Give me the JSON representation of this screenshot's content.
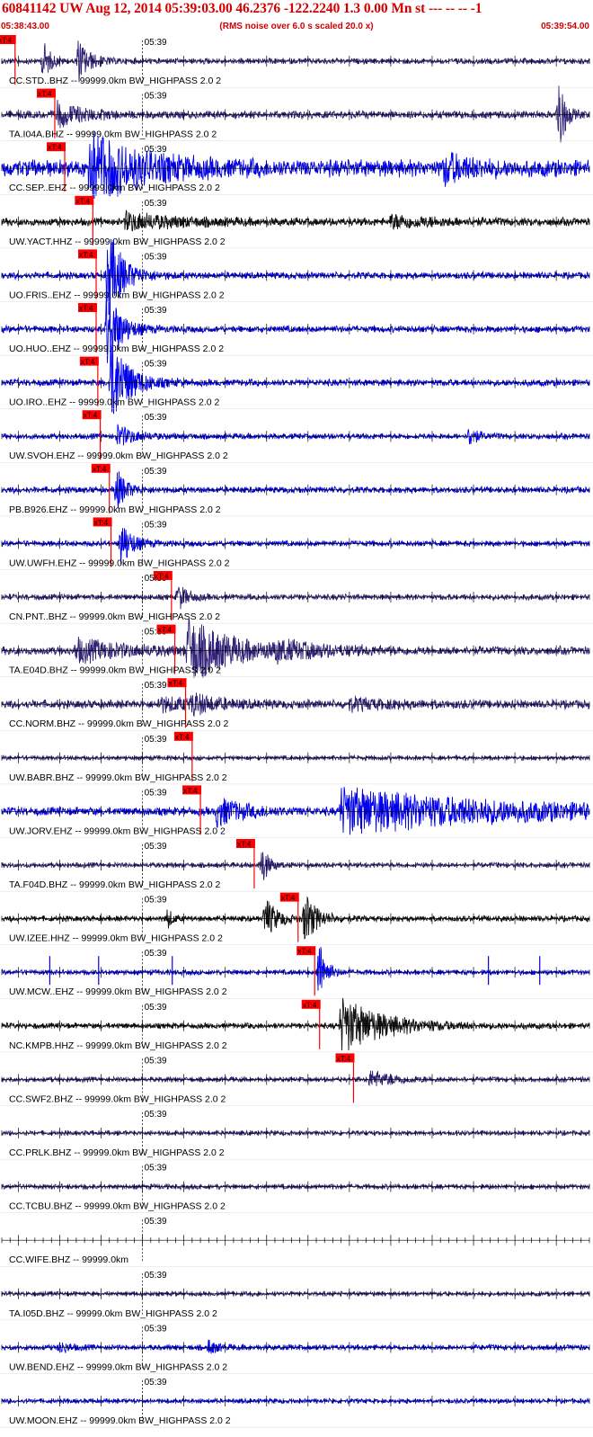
{
  "header": {
    "title": "60841142 UW Aug 12, 2014 05:39:03.00   46.2376 -122.2240  1.3 0.00 Mn st --- -- --  -1",
    "start_time": "05:38:43.00",
    "rms_note": "(RMS noise over 6.0 s scaled 20.0 x)",
    "end_time": "05:39:54.00"
  },
  "colors": {
    "header_text": "#d20000",
    "pick_flag": "#ff0000",
    "navy": "#33237a",
    "blue": "#0000ee",
    "black": "#111111",
    "axis": "#000000"
  },
  "chart_data": {
    "type": "line",
    "title": "60841142 UW Aug 12, 2014 05:39:03.00   46.2376 -122.2240  1.3 0.00 Mn st --- -- --  -1",
    "x_range": [
      "05:38:43.00",
      "05:39:54.00"
    ],
    "x_range_seconds": [
      0,
      71
    ],
    "minute_tick_label": "05:39",
    "minute_tick_second": 17,
    "pick_label": "xT:4",
    "traces": [
      {
        "label": "CC.STD..BHZ -- 99999.0km BW_HIGHPASS  2.0  2",
        "color": "navy",
        "pick_s": 1.6,
        "noise": 0.1,
        "events": [
          {
            "t": 5.0,
            "amp": 0.9,
            "dur": 0.8
          },
          {
            "t": 9.2,
            "amp": 0.9,
            "dur": 1.4
          }
        ]
      },
      {
        "label": "TA.I04A.BHZ -- 99999.0km BW_HIGHPASS  2.0  2",
        "color": "navy",
        "pick_s": 6.4,
        "noise": 0.14,
        "events": [
          {
            "t": 6.7,
            "amp": 0.5,
            "dur": 3.0
          },
          {
            "t": 67.3,
            "amp": 2.3,
            "dur": 0.6
          }
        ]
      },
      {
        "label": "CC.SEP..EHZ -- 99999.0km BW_HIGHPASS  2.0  2",
        "color": "blue",
        "pick_s": 7.6,
        "noise": 0.3,
        "events": [
          {
            "t": 10.5,
            "amp": 1.5,
            "dur": 6.0
          },
          {
            "t": 53.5,
            "amp": 0.55,
            "dur": 3.0
          }
        ]
      },
      {
        "label": "UW.YACT.HHZ -- 99999.0km BW_HIGHPASS  2.0  2",
        "color": "black",
        "pick_s": 11.0,
        "noise": 0.14,
        "events": [
          {
            "t": 15.0,
            "amp": 0.35,
            "dur": 6.0
          },
          {
            "t": 47.0,
            "amp": 0.25,
            "dur": 5.0
          }
        ]
      },
      {
        "label": "UO.FRIS..EHZ -- 99999.0km BW_HIGHPASS  2.0  2",
        "color": "blue",
        "pick_s": 11.4,
        "noise": 0.12,
        "events": [
          {
            "t": 12.8,
            "amp": 2.0,
            "dur": 1.8
          }
        ]
      },
      {
        "label": "UO.HUO..EHZ -- 99999.0km BW_HIGHPASS  2.0  2",
        "color": "blue",
        "pick_s": 11.4,
        "noise": 0.12,
        "events": [
          {
            "t": 12.7,
            "amp": 2.0,
            "dur": 1.5
          }
        ]
      },
      {
        "label": "UO.IRO..EHZ -- 99999.0km BW_HIGHPASS  2.0  2",
        "color": "blue",
        "pick_s": 11.6,
        "noise": 0.12,
        "events": [
          {
            "t": 13.2,
            "amp": 2.1,
            "dur": 2.0
          }
        ]
      },
      {
        "label": "UW.SVOH.EHZ -- 99999.0km BW_HIGHPASS  2.0  2",
        "color": "blue",
        "pick_s": 11.9,
        "noise": 0.1,
        "events": [
          {
            "t": 14.0,
            "amp": 0.45,
            "dur": 2.0
          },
          {
            "t": 56.5,
            "amp": 0.45,
            "dur": 0.9
          }
        ]
      },
      {
        "label": "PB.B926.EHZ -- 99999.0km BW_HIGHPASS  2.0  2",
        "color": "blue",
        "pick_s": 13.0,
        "noise": 0.11,
        "events": [
          {
            "t": 13.8,
            "amp": 0.9,
            "dur": 1.2
          }
        ]
      },
      {
        "label": "UW.UWFH.EHZ -- 99999.0km BW_HIGHPASS  2.0  2",
        "color": "blue",
        "pick_s": 13.2,
        "noise": 0.1,
        "events": [
          {
            "t": 14.4,
            "amp": 1.0,
            "dur": 1.3
          }
        ]
      },
      {
        "label": "CN.PNT..BHZ -- 99999.0km BW_HIGHPASS  2.0  2",
        "color": "navy",
        "pick_s": 20.5,
        "noise": 0.1,
        "events": [
          {
            "t": 21.3,
            "amp": 0.55,
            "dur": 1.2
          }
        ]
      },
      {
        "label": "TA.E04D.BHZ -- 99999.0km BW_HIGHPASS  2.0  2",
        "color": "navy",
        "pick_s": 20.9,
        "noise": 0.15,
        "events": [
          {
            "t": 9.0,
            "amp": 0.45,
            "dur": 6.0
          },
          {
            "t": 22.5,
            "amp": 1.35,
            "dur": 5.0
          },
          {
            "t": 33.0,
            "amp": 0.3,
            "dur": 6.0
          }
        ]
      },
      {
        "label": "CC.NORM.BHZ -- 99999.0km BW_HIGHPASS  2.0  2",
        "color": "navy",
        "pick_s": 22.2,
        "noise": 0.15,
        "events": [
          {
            "t": 23.0,
            "amp": 0.35,
            "dur": 2.5
          },
          {
            "t": 19.0,
            "amp": 0.25,
            "dur": 5.0
          },
          {
            "t": 42.0,
            "amp": 0.2,
            "dur": 5.0
          }
        ]
      },
      {
        "label": "UW.BABR.BHZ -- 99999.0km BW_HIGHPASS  2.0  2",
        "color": "navy",
        "pick_s": 23.0,
        "noise": 0.08,
        "events": []
      },
      {
        "label": "UW.JORV.EHZ -- 99999.0km BW_HIGHPASS  2.0  2",
        "color": "blue",
        "pick_s": 24.0,
        "noise": 0.15,
        "events": [
          {
            "t": 26.0,
            "amp": 0.6,
            "dur": 3.0
          },
          {
            "t": 41.0,
            "amp": 0.95,
            "dur": 20.0
          }
        ]
      },
      {
        "label": "TA.F04D.BHZ -- 99999.0km BW_HIGHPASS  2.0  2",
        "color": "navy",
        "pick_s": 30.5,
        "noise": 0.09,
        "events": [
          {
            "t": 31.4,
            "amp": 0.9,
            "dur": 0.8
          }
        ]
      },
      {
        "label": "UW.IZEE.HHZ -- 99999.0km BW_HIGHPASS  2.0  2",
        "color": "black",
        "pick_s": 35.8,
        "noise": 0.1,
        "events": [
          {
            "t": 20.0,
            "amp": 0.45,
            "dur": 0.6
          },
          {
            "t": 31.8,
            "amp": 0.9,
            "dur": 1.4
          },
          {
            "t": 36.6,
            "amp": 1.1,
            "dur": 1.4
          }
        ]
      },
      {
        "label": "UW.MCW..EHZ -- 99999.0km BW_HIGHPASS  2.0  2",
        "color": "blue",
        "pick_s": 37.8,
        "noise": 0.09,
        "spikes": [
          5.8,
          11.7,
          20.6,
          38.2,
          58.8,
          65.0
        ],
        "events": [
          {
            "t": 38.3,
            "amp": 1.5,
            "dur": 0.8
          }
        ]
      },
      {
        "label": "NC.KMPB.HHZ -- 99999.0km BW_HIGHPASS  2.0  2",
        "color": "black",
        "pick_s": 38.4,
        "noise": 0.1,
        "events": [
          {
            "t": 41.0,
            "amp": 1.2,
            "dur": 5.0
          }
        ]
      },
      {
        "label": "CC.SWF2.BHZ -- 99999.0km BW_HIGHPASS  2.0  2",
        "color": "navy",
        "pick_s": 42.5,
        "noise": 0.09,
        "events": [
          {
            "t": 44.5,
            "amp": 0.35,
            "dur": 3.0
          }
        ]
      },
      {
        "label": "CC.PRLK.BHZ -- 99999.0km BW_HIGHPASS  2.0  2",
        "color": "navy",
        "noise": 0.08,
        "events": []
      },
      {
        "label": "CC.TCBU.BHZ -- 99999.0km BW_HIGHPASS  2.0  2",
        "color": "navy",
        "noise": 0.09,
        "events": []
      },
      {
        "label": "CC.WIFE.BHZ -- 99999.0km",
        "color": "navy",
        "noise": 0,
        "events": [],
        "no_data": true
      },
      {
        "label": "TA.I05D.BHZ -- 99999.0km BW_HIGHPASS  2.0  2",
        "color": "navy",
        "noise": 0.08,
        "events": []
      },
      {
        "label": "UW.BEND.EHZ -- 99999.0km BW_HIGHPASS  2.0  2",
        "color": "blue",
        "noise": 0.1,
        "events": [
          {
            "t": 7.0,
            "amp": 0.25,
            "dur": 1.0
          },
          {
            "t": 25.0,
            "amp": 0.3,
            "dur": 1.0
          }
        ]
      },
      {
        "label": "UW.MOON.EHZ -- 99999.0km BW_HIGHPASS  2.0  2",
        "color": "blue",
        "noise": 0.08,
        "events": []
      }
    ]
  }
}
